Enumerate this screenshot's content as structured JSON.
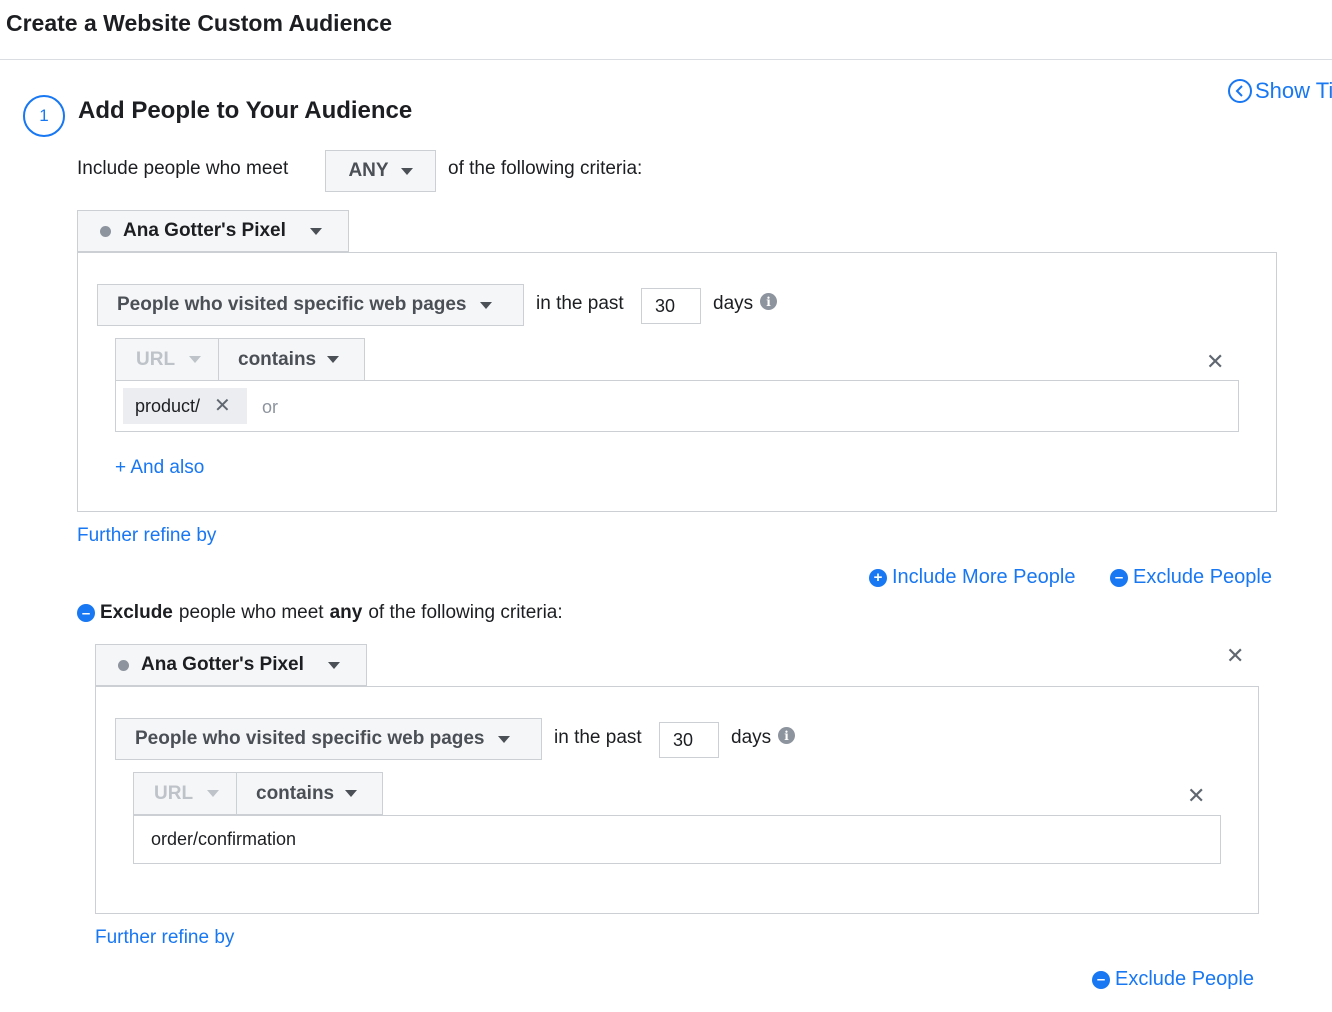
{
  "header": {
    "title": "Create a Website Custom Audience"
  },
  "step": {
    "number": "1",
    "title": "Add People to Your Audience",
    "show_tips": "Show Ti"
  },
  "include": {
    "prefix": "Include people who meet",
    "match_value": "ANY",
    "suffix": "of the following criteria:",
    "pixel_name": "Ana Gotter's Pixel",
    "rule": {
      "event": "People who visited specific web pages",
      "in_the_past": "in the past",
      "days_value": "30",
      "days_label": "days",
      "field": "URL",
      "operator": "contains",
      "tag": "product/",
      "placeholder": "or",
      "and_also": "+ And also"
    },
    "further_refine": "Further refine by",
    "include_more": "Include More People",
    "exclude_people": "Exclude People"
  },
  "exclude": {
    "word_exclude": "Exclude",
    "text_mid": "people who meet",
    "word_any": "any",
    "text_end": "of the following criteria:",
    "pixel_name": "Ana Gotter's Pixel",
    "rule": {
      "event": "People who visited specific web pages",
      "in_the_past": "in the past",
      "days_value": "30",
      "days_label": "days",
      "field": "URL",
      "operator": "contains",
      "value": "order/confirmation"
    },
    "further_refine": "Further refine by",
    "exclude_people": "Exclude People"
  },
  "icons": {
    "info": "i",
    "close": "✕",
    "plus": "+",
    "minus": "–",
    "chevron_left": "‹"
  },
  "colors": {
    "accent": "#1877f2",
    "text": "#1c1e21",
    "muted": "#4b4f56",
    "border": "#ccd0d5"
  }
}
